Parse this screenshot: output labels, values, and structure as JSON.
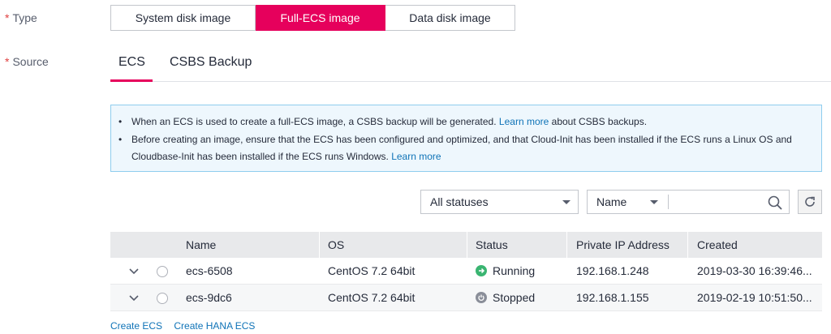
{
  "form": {
    "type_label": "Type",
    "source_label": "Source",
    "required_mark": "*"
  },
  "type_options": [
    {
      "label": "System disk image",
      "selected": false
    },
    {
      "label": "Full-ECS image",
      "selected": true
    },
    {
      "label": "Data disk image",
      "selected": false
    }
  ],
  "source_tabs": [
    {
      "label": "ECS",
      "active": true
    },
    {
      "label": "CSBS Backup",
      "active": false
    }
  ],
  "notice": {
    "line1_text": "When an ECS is used to create a full-ECS image, a CSBS backup will be generated.",
    "line1_link": "Learn more",
    "line1_suffix": "about CSBS backups.",
    "line2_text": "Before creating an image, ensure that the ECS has been configured and optimized, and that Cloud-Init has been installed if the ECS runs a Linux OS and",
    "line3_text": "Cloudbase-Init has been installed if the ECS runs Windows.",
    "line3_link": "Learn more"
  },
  "filters": {
    "status_value": "All statuses",
    "search_field_value": "Name",
    "search_value": ""
  },
  "table": {
    "columns": [
      "Name",
      "OS",
      "Status",
      "Private IP Address",
      "Created"
    ],
    "rows": [
      {
        "name": "ecs-6508",
        "os": "CentOS 7.2 64bit",
        "status": "Running",
        "ip": "192.168.1.248",
        "created": "2019-03-30 16:39:46..."
      },
      {
        "name": "ecs-9dc6",
        "os": "CentOS 7.2 64bit",
        "status": "Stopped",
        "ip": "192.168.1.155",
        "created": "2019-02-19 10:51:50..."
      }
    ]
  },
  "links": {
    "create_ecs": "Create ECS",
    "create_hana_ecs": "Create HANA ECS"
  },
  "colors": {
    "accent": "#e6005c",
    "link": "#0f73b7",
    "running": "#3ab571",
    "stopped": "#8a8e99"
  }
}
